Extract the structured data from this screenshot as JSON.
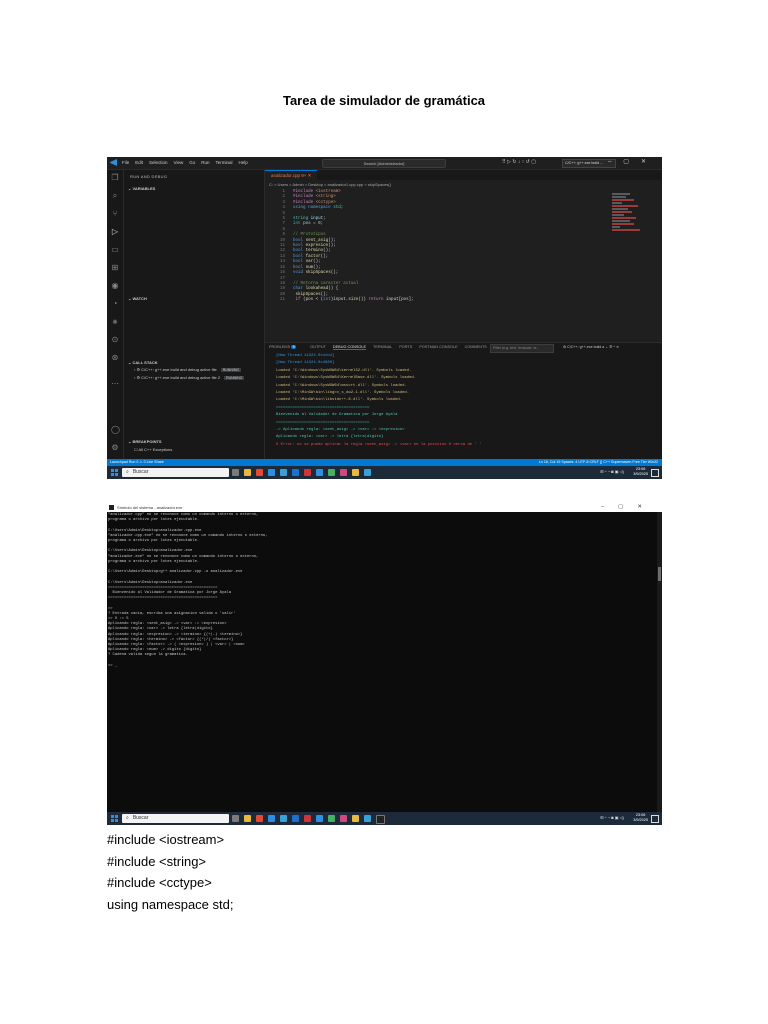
{
  "document": {
    "title": "Tarea de simulador de gramática",
    "code_lines": [
      "#include <iostream>",
      "#include <string>",
      "#include <cctype>",
      "using namespace std;"
    ]
  },
  "vscode": {
    "menu": [
      "File",
      "Edit",
      "Selection",
      "View",
      "Go",
      "Run",
      "Terminal",
      "Help"
    ],
    "search_placeholder": "Search [Administrador]",
    "run_config": "C/C++: g++.exe build ...",
    "sidebar": {
      "header": "RUN AND DEBUG",
      "variables": "VARIABLES",
      "watch": "WATCH",
      "call_stack": "CALL STACK",
      "call_stack_items": [
        {
          "label": "C/C++: g++.exe build and debug active file",
          "status": "RUNNING"
        },
        {
          "label": "C/C++: g++.exe build and debug active file 2",
          "status": "RUNNING"
        }
      ],
      "breakpoints": "BREAKPOINTS",
      "breakpoint_item": "All C++ Exceptions"
    },
    "tab_label": "analizador.cpp 9+",
    "breadcrumb": "C: > Users > Admin > Desktop > analizador1.cpp.cpp > skipSpaces()",
    "code": [
      {
        "n": "1",
        "segs": [
          [
            "inc",
            "#include "
          ],
          [
            "str",
            "<iostream>"
          ]
        ]
      },
      {
        "n": "2",
        "segs": [
          [
            "inc",
            "#include "
          ],
          [
            "str",
            "<string>"
          ]
        ]
      },
      {
        "n": "3",
        "segs": [
          [
            "inc",
            "#include "
          ],
          [
            "str",
            "<cctype>"
          ]
        ]
      },
      {
        "n": "4",
        "segs": [
          [
            "kw",
            "using namespace "
          ],
          [
            "ty",
            "std"
          ],
          [
            "tx",
            ";"
          ]
        ]
      },
      {
        "n": "5",
        "segs": []
      },
      {
        "n": "6",
        "segs": [
          [
            "ty",
            "string "
          ],
          [
            "var",
            "input"
          ],
          [
            "tx",
            ";"
          ]
        ]
      },
      {
        "n": "7",
        "segs": [
          [
            "kw",
            "int "
          ],
          [
            "var",
            "pos"
          ],
          [
            "tx",
            " = "
          ],
          [
            "nm",
            "0"
          ],
          [
            "tx",
            ";"
          ]
        ]
      },
      {
        "n": "8",
        "segs": []
      },
      {
        "n": "9",
        "segs": [
          [
            "cm",
            "// Prototipos"
          ]
        ]
      },
      {
        "n": "10",
        "segs": [
          [
            "kw",
            "bool "
          ],
          [
            "fn",
            "sent_asig"
          ],
          [
            "tx",
            "();"
          ]
        ]
      },
      {
        "n": "11",
        "segs": [
          [
            "kw",
            "bool "
          ],
          [
            "fn",
            "expresion"
          ],
          [
            "tx",
            "();"
          ]
        ]
      },
      {
        "n": "12",
        "segs": [
          [
            "kw",
            "bool "
          ],
          [
            "fn",
            "termino"
          ],
          [
            "tx",
            "();"
          ]
        ]
      },
      {
        "n": "13",
        "segs": [
          [
            "kw",
            "bool "
          ],
          [
            "fn",
            "factor"
          ],
          [
            "tx",
            "();"
          ]
        ]
      },
      {
        "n": "14",
        "segs": [
          [
            "kw",
            "bool "
          ],
          [
            "fn",
            "var"
          ],
          [
            "tx",
            "();"
          ]
        ]
      },
      {
        "n": "15",
        "segs": [
          [
            "kw",
            "bool "
          ],
          [
            "fn",
            "num"
          ],
          [
            "tx",
            "();"
          ]
        ]
      },
      {
        "n": "16",
        "segs": [
          [
            "kw",
            "void "
          ],
          [
            "fn",
            "skipSpaces"
          ],
          [
            "tx",
            "();"
          ]
        ]
      },
      {
        "n": "17",
        "segs": []
      },
      {
        "n": "18",
        "segs": [
          [
            "cm",
            "// Retorna caracter actual"
          ]
        ]
      },
      {
        "n": "19",
        "segs": [
          [
            "kw",
            "char "
          ],
          [
            "fn",
            "lookahead"
          ],
          [
            "tx",
            "() {"
          ]
        ]
      },
      {
        "n": "20",
        "segs": [
          [
            "tx",
            "    "
          ],
          [
            "fn",
            "skipSpaces"
          ],
          [
            "tx",
            "();"
          ]
        ]
      },
      {
        "n": "21",
        "segs": [
          [
            "tx",
            "    "
          ],
          [
            "inc",
            "if "
          ],
          [
            "tx",
            "(pos < ("
          ],
          [
            "kw",
            "int"
          ],
          [
            "tx",
            ")input."
          ],
          [
            "fn",
            "size"
          ],
          [
            "tx",
            "()) "
          ],
          [
            "inc",
            "return "
          ],
          [
            "tx",
            "input[pos];"
          ]
        ]
      }
    ],
    "panel_tabs": [
      "PROBLEMS",
      "OUTPUT",
      "DEBUG CONSOLE",
      "TERMINAL",
      "PORTS",
      "POSTMAN CONSOLE",
      "COMMENTS"
    ],
    "problems_count": "9",
    "filter_placeholder": "Filter (e.g. text, !exclude, \\e...",
    "panel_run_config": "C/C++: g++.exe build a",
    "console_lines": [
      {
        "c": "c-blue",
        "t": "[New Thread 11324.0x1cb4]"
      },
      {
        "c": "c-blue",
        "t": "[New Thread 11324.0x4680]"
      },
      {
        "c": "c-yel",
        "t": "Loaded 'C:\\Windows\\SysWOW64\\kernel32.dll'. Symbols loaded."
      },
      {
        "c": "c-yel",
        "t": "Loaded 'C:\\Windows\\SysWOW64\\KernelBase.dll'. Symbols loaded."
      },
      {
        "c": "c-yel",
        "t": "Loaded 'C:\\Windows\\SysWOW64\\msvcrt.dll'. Symbols loaded."
      },
      {
        "c": "c-yel",
        "t": "Loaded 'C:\\MinGW\\bin\\libgcc_s_dw2-1.dll'. Symbols loaded."
      },
      {
        "c": "c-yel",
        "t": "Loaded 'C:\\MinGW\\bin\\libstdc++-6.dll'. Symbols loaded."
      },
      {
        "c": "c-grn",
        "t": "========================================"
      },
      {
        "c": "c-grn",
        "t": "  Bienvenido al Validador de Gramatica por Jorge Ayala"
      },
      {
        "c": "c-grn",
        "t": "========================================"
      },
      {
        "c": "c-grn",
        "t": "-> Aplicando regla: <sent_asig> -> <var> := <expresion>"
      },
      {
        "c": "c-grn",
        "t": "Aplicando regla: <var> -> letra {letra|digito}"
      },
      {
        "c": "c-red",
        "t": "X Error: no se puede aplicar la regla <sent_asig> -> <var> en la posicion 0 cerca de ' '"
      }
    ],
    "status_left": "Launchpad   Run   0 ⚠ 0   Live Share",
    "status_right": "Ln 16, Col 19   Spaces: 4   UTF-8   CRLF   {} C++   Supermaven Free Tier   Win32",
    "taskbar_search": "Buscar",
    "clock_time": "23:06",
    "clock_date": "3/9/2025"
  },
  "cmd": {
    "title": "Símbolo del sistema - analizador.exe",
    "lines": [
      "\"analizador.cpp\" no se reconoce como un comando interno o externo,",
      "programa o archivo por lotes ejecutable.",
      "",
      "C:\\Users\\Admin\\Desktop>analizador.cpp.exe",
      "\"analizador.cpp.exe\" no se reconoce como un comando interno o externo,",
      "programa o archivo por lotes ejecutable.",
      "",
      "C:\\Users\\Admin\\Desktop>analizador.exe",
      "\"analizador.exe\" no se reconoce como un comando interno o externo,",
      "programa o archivo por lotes ejecutable.",
      "",
      "C:\\Users\\Admin\\Desktop>g++ analizador.cpp -o analizador.exe",
      "",
      "C:\\Users\\Admin\\Desktop>analizador.exe",
      "================================================",
      "  Bienvenido al Validador de Gramatica por Jorge Ayala",
      "================================================",
      "",
      ">>",
      "? Entrada vacia, escriba una asignacion valida o 'salir'",
      ">> X := 5",
      "Aplicando regla: <sent_asig> -> <var> := <expresion>",
      "Aplicando regla: <var> -> letra {letra|digito}",
      "Aplicando regla: <expresion> -> <termino> {(+|-) <termino>}",
      "Aplicando regla: <termino> -> <factor> {(*|/) <factor>}",
      "Aplicando regla: <factor> -> ( <expresion> ) | <var> | <num>",
      "Aplicando regla: <num> -> digito {digito}",
      "? Cadena valida segun la gramatica.",
      "",
      ">> _"
    ],
    "taskbar_search": "Buscar",
    "clock_time": "23:06",
    "clock_date": "3/9/2025"
  }
}
